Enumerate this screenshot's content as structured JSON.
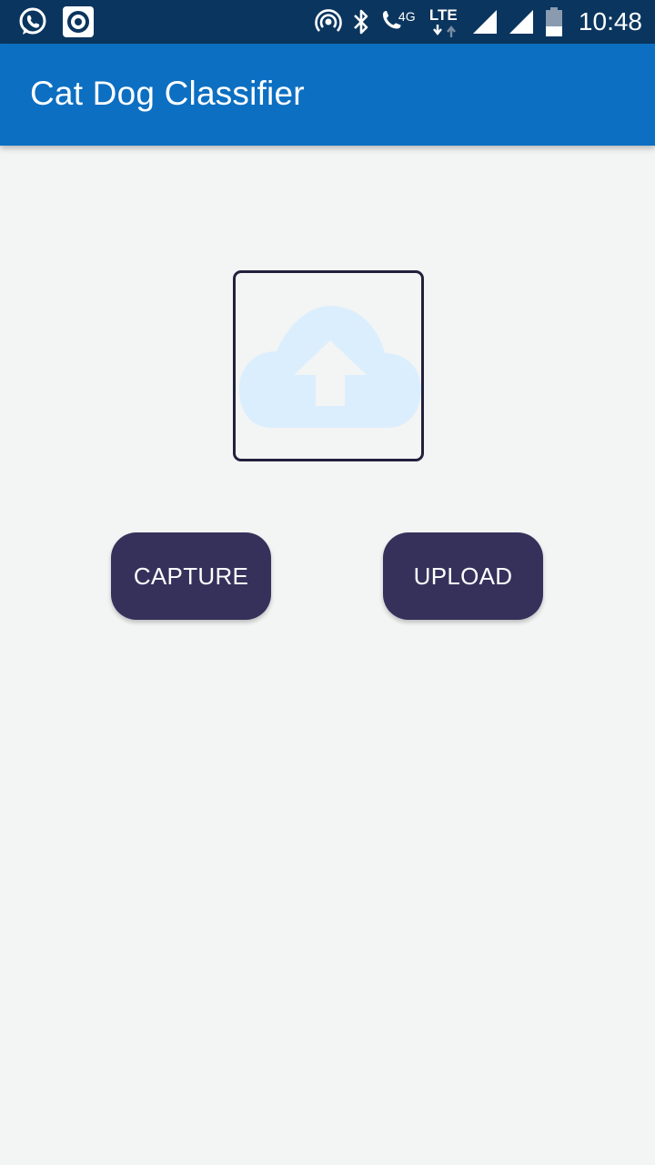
{
  "status_bar": {
    "left_icons": [
      "whatsapp-icon",
      "music-player-icon"
    ],
    "right_icons": [
      "hotspot-icon",
      "bluetooth-icon",
      "volte-call-icon",
      "lte-icon",
      "signal-icon",
      "signal-icon-2",
      "battery-icon"
    ],
    "network_4g": "4G",
    "network_lte": "LTE",
    "time": "10:48"
  },
  "app_bar": {
    "title": "Cat Dog Classifier",
    "color": "#0c6fc2"
  },
  "image_placeholder": {
    "icon": "cloud-upload-icon",
    "icon_color": "#dbeefd"
  },
  "actions": {
    "capture_label": "CAPTURE",
    "upload_label": "UPLOAD",
    "button_color": "#36315b"
  }
}
